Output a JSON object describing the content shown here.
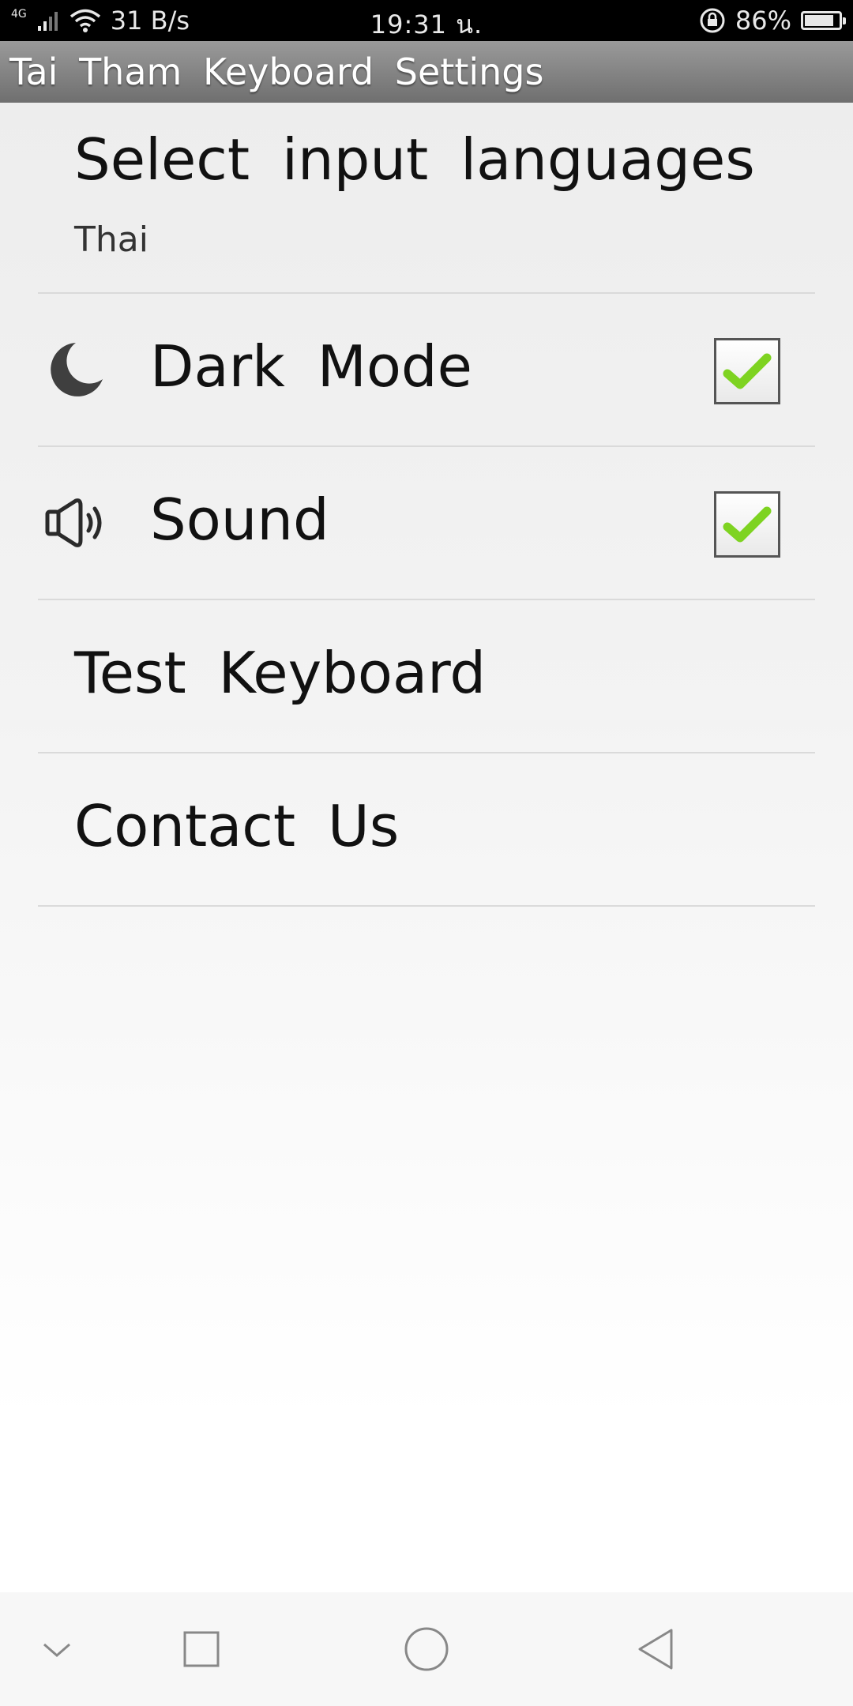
{
  "status_bar": {
    "network_type": "4G",
    "speed": "31 B/s",
    "time": "19:31 น.",
    "battery_percent": "86%",
    "battery_level": 0.86
  },
  "header": {
    "title": "Tai Tham Keyboard Settings"
  },
  "settings": {
    "input_languages": {
      "title": "Select input languages",
      "summary": "Thai"
    },
    "dark_mode": {
      "title": "Dark Mode",
      "icon": "moon-icon",
      "checked": true
    },
    "sound": {
      "title": "Sound",
      "icon": "speaker-icon",
      "checked": true
    },
    "test_keyboard": {
      "title": "Test Keyboard"
    },
    "contact_us": {
      "title": "Contact Us"
    }
  },
  "nav_bar": {
    "buttons": [
      "collapse-icon",
      "recents-icon",
      "home-icon",
      "back-icon"
    ]
  },
  "colors": {
    "check": "#7ed321",
    "title_bar": "#8a8a8a"
  }
}
